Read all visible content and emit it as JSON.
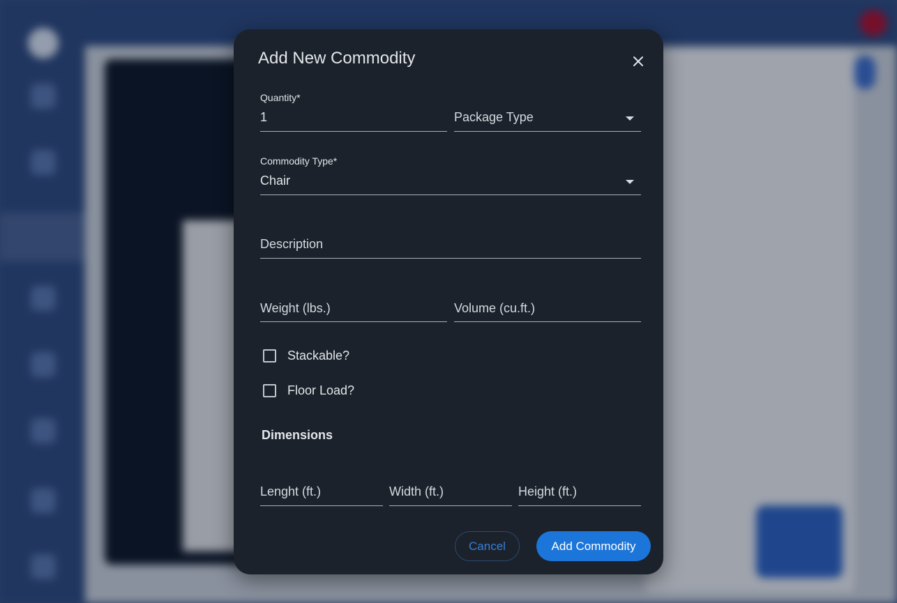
{
  "dialog": {
    "title": "Add New Commodity",
    "close_icon": "close-icon",
    "quantity": {
      "label": "Quantity*",
      "value": "1"
    },
    "package_type": {
      "placeholder": "Package Type"
    },
    "commodity_type": {
      "label": "Commodity Type*",
      "value": "Chair"
    },
    "description": {
      "placeholder": "Description"
    },
    "weight": {
      "placeholder": "Weight (lbs.)"
    },
    "volume": {
      "placeholder": "Volume (cu.ft.)"
    },
    "stackable": {
      "label": "Stackable?",
      "checked": false
    },
    "floor_load": {
      "label": "Floor Load?",
      "checked": false
    },
    "dimensions_title": "Dimensions",
    "length": {
      "placeholder": "Lenght (ft.)"
    },
    "width": {
      "placeholder": "Width (ft.)"
    },
    "height": {
      "placeholder": "Height (ft.)"
    },
    "cancel_label": "Cancel",
    "submit_label": "Add Commodity"
  },
  "colors": {
    "dialog_bg": "#1b222b",
    "primary": "#1c75d8",
    "cancel_text": "#3a7ed6"
  }
}
